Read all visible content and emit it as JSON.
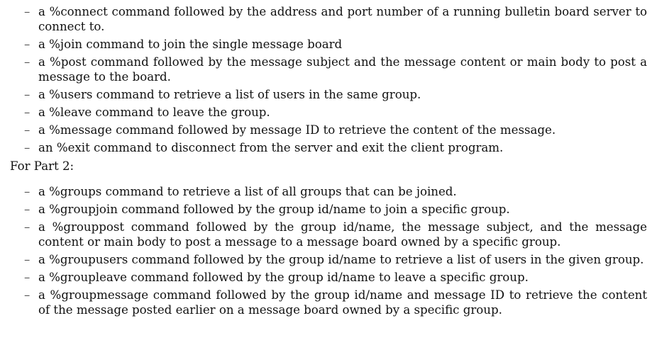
{
  "part1": {
    "items": [
      "a %connect command followed by the address and port number of a running bulletin board server to connect to.",
      "a %join command to join the single message board",
      "a %post command followed by the message subject and the message content or main body to post a message to the board.",
      "a %users command to retrieve a list of users in the same group.",
      "a %leave command to leave the group.",
      "a %message command followed by message ID to retrieve the content of the message.",
      "an %exit command to disconnect from the server and exit the client program."
    ]
  },
  "part2": {
    "heading": "For Part 2:",
    "items": [
      "a %groups command to retrieve a list of all groups that can be joined.",
      "a %groupjoin command followed by the group id/name to join a specific group.",
      "a %grouppost command followed by the group id/name, the message subject, and the message content or main body to post a message to a message board owned by a specific group.",
      "a %groupusers command followed by the group id/name to retrieve a list of users in the given group.",
      "a %groupleave command followed by the group id/name to leave a specific group.",
      "a %groupmessage command followed by the group id/name and message ID to retrieve the content of the message posted earlier on a message board owned by a specific group."
    ]
  },
  "bullet_symbol": "–"
}
